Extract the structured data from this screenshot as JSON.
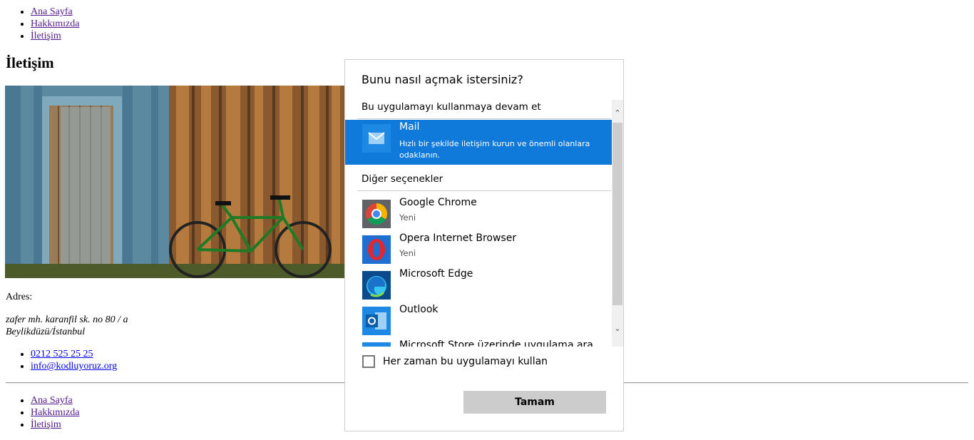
{
  "nav": {
    "items": [
      "Ana Sayfa",
      "Hakkımızda",
      "İletişim"
    ]
  },
  "page": {
    "heading": "İletişim",
    "address_label": "Adres:",
    "address_line1": "zafer mh. karanfil sk. no 80 / a",
    "address_line2": "Beylikdüzü/İstanbul",
    "phone": "0212 525 25 25",
    "email": "info@kodluyoruz.org"
  },
  "footer_nav": {
    "items": [
      "Ana Sayfa",
      "Hakkımızda",
      "İletişim"
    ]
  },
  "dialog": {
    "title": "Bunu nasıl açmak istersiniz?",
    "section_current": "Bu uygulamayı kullanmaya devam et",
    "selected_app": {
      "name": "Mail",
      "description": "Hızlı bir şekilde iletişim kurun ve önemli olanlara odaklanın.",
      "icon": "mail-icon"
    },
    "section_other": "Diğer seçenekler",
    "apps": [
      {
        "name": "Google Chrome",
        "sub": "Yeni",
        "icon": "chrome-icon"
      },
      {
        "name": "Opera Internet Browser",
        "sub": "Yeni",
        "icon": "opera-icon"
      },
      {
        "name": "Microsoft Edge",
        "sub": "",
        "icon": "edge-icon"
      },
      {
        "name": "Outlook",
        "sub": "",
        "icon": "outlook-icon"
      },
      {
        "name": "Microsoft Store üzerinde uygulama ara",
        "sub": "",
        "icon": "store-icon"
      }
    ],
    "always_label": "Her zaman bu uygulamayı kullan",
    "always_checked": false,
    "ok_label": "Tamam",
    "colors": {
      "accent": "#0f7ad9",
      "button": "#cccccc"
    }
  }
}
